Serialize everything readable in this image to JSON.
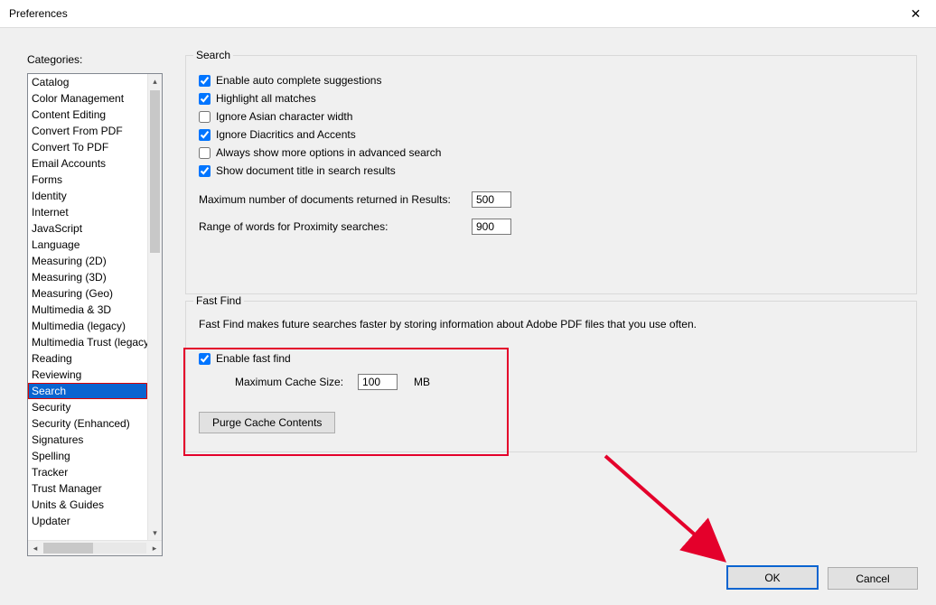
{
  "window": {
    "title": "Preferences",
    "close_glyph": "✕"
  },
  "sidebar": {
    "label": "Categories:",
    "items": [
      "Catalog",
      "Color Management",
      "Content Editing",
      "Convert From PDF",
      "Convert To PDF",
      "Email Accounts",
      "Forms",
      "Identity",
      "Internet",
      "JavaScript",
      "Language",
      "Measuring (2D)",
      "Measuring (3D)",
      "Measuring (Geo)",
      "Multimedia & 3D",
      "Multimedia (legacy)",
      "Multimedia Trust (legacy)",
      "Reading",
      "Reviewing",
      "Search",
      "Security",
      "Security (Enhanced)",
      "Signatures",
      "Spelling",
      "Tracker",
      "Trust Manager",
      "Units & Guides",
      "Updater"
    ],
    "selected_index": 19
  },
  "search_group": {
    "legend": "Search",
    "enable_autocomplete": "Enable auto complete suggestions",
    "highlight_all": "Highlight all matches",
    "ignore_asian": "Ignore Asian character width",
    "ignore_diacritics": "Ignore Diacritics and Accents",
    "always_show_more": "Always show more options in advanced search",
    "show_doc_title": "Show document title in search results",
    "max_docs_label": "Maximum number of documents returned in Results:",
    "max_docs_value": "500",
    "proximity_label": "Range of words for Proximity searches:",
    "proximity_value": "900"
  },
  "fastfind_group": {
    "legend": "Fast Find",
    "description": "Fast Find makes future searches faster by storing information about Adobe PDF files that you use often.",
    "enable_label": "Enable fast find",
    "cache_label": "Maximum Cache Size:",
    "cache_value": "100",
    "cache_unit": "MB",
    "purge_label": "Purge Cache Contents"
  },
  "buttons": {
    "ok": "OK",
    "cancel": "Cancel"
  }
}
